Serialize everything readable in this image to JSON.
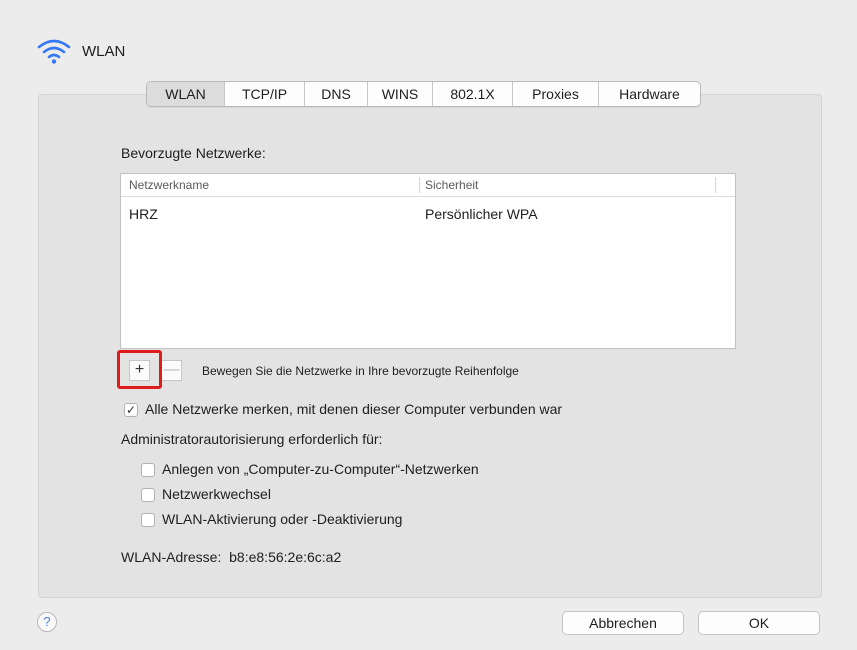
{
  "header": {
    "title": "WLAN",
    "icon": "wifi-icon",
    "icon_color": "#3478f6"
  },
  "tabs": [
    "WLAN",
    "TCP/IP",
    "DNS",
    "WINS",
    "802.1X",
    "Proxies",
    "Hardware"
  ],
  "active_tab": "WLAN",
  "preferred": {
    "label": "Bevorzugte Netzwerke:",
    "columns": [
      "Netzwerkname",
      "Sicherheit"
    ],
    "rows": [
      {
        "name": "HRZ",
        "security": "Persönlicher WPA"
      }
    ]
  },
  "controls": {
    "add_label": "+",
    "remove_label": "—",
    "reorder_hint": "Bewegen Sie die Netzwerke in Ihre bevorzugte Reihenfolge",
    "highlight_color": "#e01b1b"
  },
  "options": {
    "remember_label": "Alle Netzwerke merken, mit denen dieser Computer verbunden war",
    "remember_checked": true,
    "admin_label": "Administratorautorisierung erforderlich für:",
    "admin_items": [
      {
        "label": "Anlegen von „Computer-zu-Computer“-Netzwerken",
        "checked": false
      },
      {
        "label": "Netzwerkwechsel",
        "checked": false
      },
      {
        "label": "WLAN-Aktivierung oder -Deaktivierung",
        "checked": false
      }
    ]
  },
  "address": {
    "label": "WLAN-Adresse:",
    "value": "b8:e8:56:2e:6c:a2"
  },
  "footer": {
    "help_label": "?",
    "cancel_label": "Abbrechen",
    "ok_label": "OK"
  }
}
